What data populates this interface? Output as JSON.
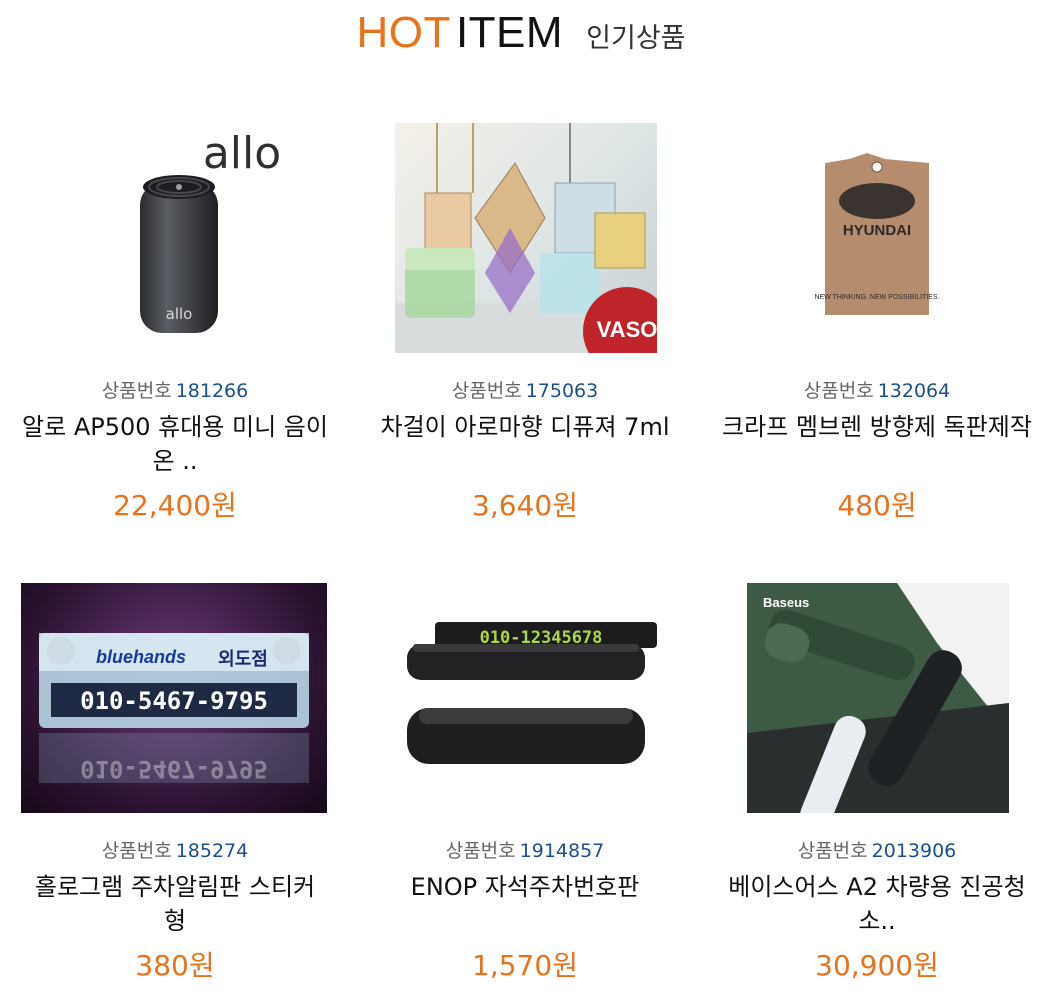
{
  "header": {
    "hot": "HOT",
    "item": "ITEM",
    "subtitle": "인기상품",
    "accent": "#e8731c"
  },
  "product_code_label": "상품번호",
  "products": [
    {
      "code": "181266",
      "name": "알로 AP500 휴대용 미니 음이온 ..",
      "price": "22,400원",
      "image_text": "allo",
      "image_icon": "air-purifier-image"
    },
    {
      "code": "175063",
      "name": "차걸이 아로마향 디퓨져 7ml",
      "price": "3,640원",
      "image_text": "VASO",
      "image_icon": "diffuser-image"
    },
    {
      "code": "132064",
      "name": "크라프 멤브렌 방향제 독판제작",
      "price": "480원",
      "image_text": "HYUNDAI",
      "image_sub": "NEW THINKING. NEW POSSIBILITIES.",
      "image_icon": "air-freshener-image"
    },
    {
      "code": "185274",
      "name": "홀로그램 주차알림판 스티커형",
      "price": "380원",
      "image_text": "010-5467-9795",
      "image_sub": "외도점",
      "image_brand": "bluehands",
      "image_icon": "parking-sign-image"
    },
    {
      "code": "1914857",
      "name": "ENOP 자석주차번호판",
      "price": "1,570원",
      "image_text": "010-12345678",
      "image_icon": "parking-plate-image"
    },
    {
      "code": "2013906",
      "name": "베이스어스 A2 차량용 진공청소..",
      "price": "30,900원",
      "image_text": "Baseus",
      "image_icon": "vacuum-image"
    }
  ]
}
